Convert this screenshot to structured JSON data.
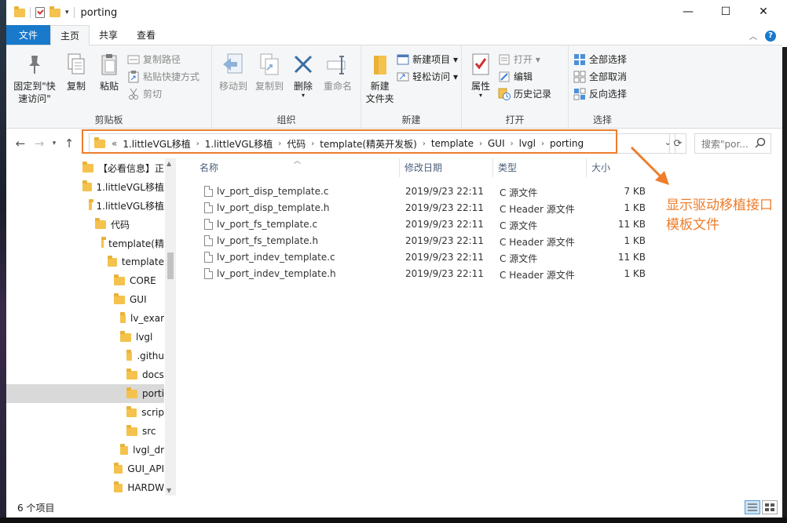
{
  "window": {
    "title": "porting",
    "controls": {
      "minimize": "—",
      "maximize": "☐",
      "close": "✕"
    }
  },
  "ribbon_tabs": [
    "文件",
    "主页",
    "共享",
    "查看"
  ],
  "ribbon": {
    "clipboard": {
      "pin": "固定到\"快速访问\"",
      "copy": "复制",
      "paste": "粘贴",
      "copy_path": "复制路径",
      "paste_shortcut": "粘贴快捷方式",
      "cut": "剪切",
      "label": "剪贴板"
    },
    "organize": {
      "move_to": "移动到",
      "copy_to": "复制到",
      "delete": "删除",
      "rename": "重命名",
      "label": "组织"
    },
    "new": {
      "new_folder": "新建\n文件夹",
      "new_item": "新建项目 ▾",
      "easy_access": "轻松访问 ▾",
      "label": "新建"
    },
    "open": {
      "properties": "属性",
      "open": "打开 ▾",
      "edit": "编辑",
      "history": "历史记录",
      "label": "打开"
    },
    "select": {
      "select_all": "全部选择",
      "select_none": "全部取消",
      "invert": "反向选择",
      "label": "选择"
    }
  },
  "address": {
    "overflow": "«",
    "crumbs": [
      "1.littleVGL移植",
      "1.littleVGL移植",
      "代码",
      "template(精英开发板)",
      "template",
      "GUI",
      "lvgl",
      "porting"
    ],
    "search_placeholder": "搜索\"por..."
  },
  "tree": [
    {
      "label": "【必看信息】正"
    },
    {
      "label": "1.littleVGL移植"
    },
    {
      "label": "1.littleVGL移植"
    },
    {
      "label": "代码"
    },
    {
      "label": "template(精"
    },
    {
      "label": "template"
    },
    {
      "label": "CORE"
    },
    {
      "label": "GUI"
    },
    {
      "label": "lv_exar"
    },
    {
      "label": "lvgl"
    },
    {
      "label": ".githu"
    },
    {
      "label": "docs"
    },
    {
      "label": "porti"
    },
    {
      "label": "scrip"
    },
    {
      "label": "src"
    },
    {
      "label": "lvgl_dr"
    },
    {
      "label": "GUI_API"
    },
    {
      "label": "HARDW"
    }
  ],
  "columns": [
    "名称",
    "修改日期",
    "类型",
    "大小"
  ],
  "files": [
    {
      "name": "lv_port_disp_template.c",
      "date": "2019/9/23 22:11",
      "type": "C 源文件",
      "size": "7 KB"
    },
    {
      "name": "lv_port_disp_template.h",
      "date": "2019/9/23 22:11",
      "type": "C Header 源文件",
      "size": "1 KB"
    },
    {
      "name": "lv_port_fs_template.c",
      "date": "2019/9/23 22:11",
      "type": "C 源文件",
      "size": "11 KB"
    },
    {
      "name": "lv_port_fs_template.h",
      "date": "2019/9/23 22:11",
      "type": "C Header 源文件",
      "size": "1 KB"
    },
    {
      "name": "lv_port_indev_template.c",
      "date": "2019/9/23 22:11",
      "type": "C 源文件",
      "size": "11 KB"
    },
    {
      "name": "lv_port_indev_template.h",
      "date": "2019/9/23 22:11",
      "type": "C Header 源文件",
      "size": "1 KB"
    }
  ],
  "annotation": "显示驱动移植接口模板文件",
  "status": {
    "item_count": "6 个项目"
  },
  "colors": {
    "accent": "#1979ca",
    "annotation": "#ee7d2c",
    "folder": "#f4c24d"
  }
}
